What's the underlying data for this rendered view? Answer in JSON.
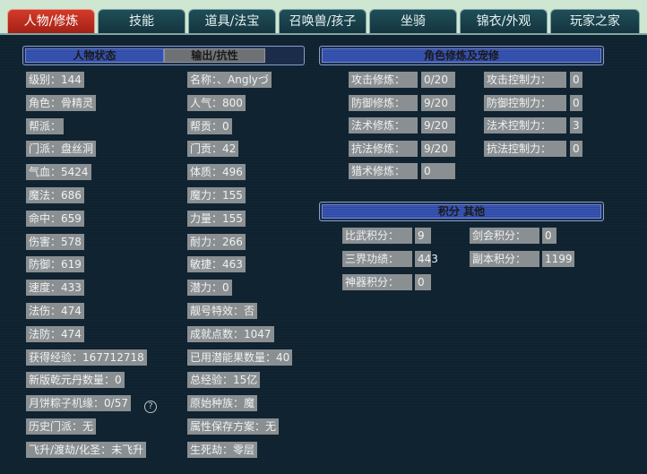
{
  "tabs": [
    "人物/修炼",
    "技能",
    "道具/法宝",
    "召唤兽/孩子",
    "坐骑",
    "锦衣/外观",
    "玩家之家"
  ],
  "headers": {
    "status": "人物状态",
    "output": "输出/抗性",
    "cultivation": "角色修炼及宠修",
    "points": "积分 其他"
  },
  "left_col": [
    {
      "label": "级别：",
      "value": "144"
    },
    {
      "label": "角色：",
      "value": "骨精灵"
    },
    {
      "label": "帮派：",
      "value": ""
    },
    {
      "label": "门派：",
      "value": "盘丝洞"
    },
    {
      "label": "气血：",
      "value": "5424"
    },
    {
      "label": "魔法：",
      "value": "686"
    },
    {
      "label": "命中：",
      "value": "659"
    },
    {
      "label": "伤害：",
      "value": "578"
    },
    {
      "label": "防御：",
      "value": "619"
    },
    {
      "label": "速度：",
      "value": "433"
    },
    {
      "label": "法伤：",
      "value": "474"
    },
    {
      "label": "法防：",
      "value": "474"
    },
    {
      "label": "获得经验：",
      "value": "167712718"
    },
    {
      "label": "新版乾元丹数量：",
      "value": "0"
    },
    {
      "label": "月饼粽子机缘：",
      "value": "0/57"
    },
    {
      "label": "历史门派：",
      "value": "无"
    },
    {
      "label": "飞升/渡劫/化圣：",
      "value": "未飞升"
    }
  ],
  "mid_col": [
    {
      "label": "名称：",
      "value": "、Anglyづ"
    },
    {
      "label": "人气：",
      "value": "800"
    },
    {
      "label": "帮贡：",
      "value": "0"
    },
    {
      "label": "门贡：",
      "value": "42"
    },
    {
      "label": "体质：",
      "value": "496"
    },
    {
      "label": "魔力：",
      "value": "155"
    },
    {
      "label": "力量：",
      "value": "155"
    },
    {
      "label": "耐力：",
      "value": "266"
    },
    {
      "label": "敏捷：",
      "value": "463"
    },
    {
      "label": "潜力：",
      "value": "0"
    },
    {
      "label": "靓号特效：",
      "value": "否"
    },
    {
      "label": "成就点数：",
      "value": "1047"
    },
    {
      "label": "已用潜能果数量：",
      "value": "40"
    },
    {
      "label": "总经验：",
      "value": "15亿"
    },
    {
      "label": "原始种族：",
      "value": "魔"
    },
    {
      "label": "属性保存方案：",
      "value": "无"
    },
    {
      "label": "生死劫：",
      "value": "零层"
    }
  ],
  "cultivation": [
    {
      "label": "攻击修炼：",
      "value": "0/20",
      "label2": "攻击控制力：",
      "value2": "0"
    },
    {
      "label": "防御修炼：",
      "value": "9/20",
      "label2": "防御控制力：",
      "value2": "0"
    },
    {
      "label": "法术修炼：",
      "value": "9/20",
      "label2": "法术控制力：",
      "value2": "3"
    },
    {
      "label": "抗法修炼：",
      "value": "9/20",
      "label2": "抗法控制力：",
      "value2": "0"
    },
    {
      "label": "猎术修炼：",
      "value": "0"
    }
  ],
  "points": [
    {
      "label": "比武积分：",
      "value": "9",
      "label2": "剑会积分：",
      "value2": "0"
    },
    {
      "label": "三界功绩：",
      "value": "443",
      "label2": "副本积分：",
      "value2": "1199"
    },
    {
      "label": "神器积分：",
      "value": "0"
    }
  ],
  "help_icon": "question-circle-icon"
}
